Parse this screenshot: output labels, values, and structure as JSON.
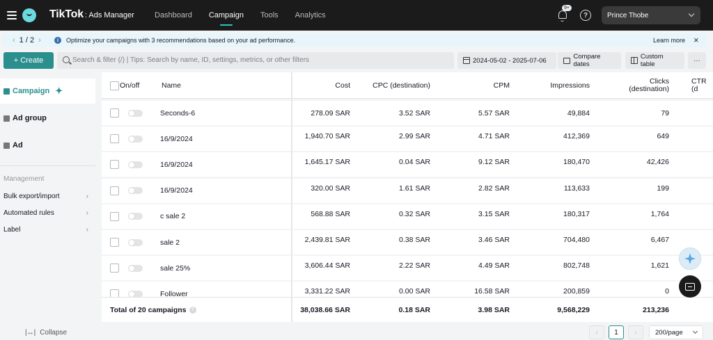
{
  "nav": {
    "brand": "TikTok",
    "brand_sub": ": Ads Manager",
    "links": [
      "Dashboard",
      "Campaign",
      "Tools",
      "Analytics"
    ],
    "notification_badge": "9+",
    "help_glyph": "?",
    "account_name": "Prince Thobe"
  },
  "recommendation": {
    "pager": "1 / 2",
    "message": "Optimize your campaigns with 3 recommendations based on your ad performance.",
    "learn_more": "Learn more"
  },
  "toolbar": {
    "create_label": "+ Create",
    "search_placeholder": "Search & filter (/) | Tips: Search by name, ID, settings, metrics, or other filters",
    "date_range": "2024-05-02 - 2025-07-06",
    "compare_label": "Compare dates",
    "custom_table_label": "Custom table",
    "more_label": "···"
  },
  "sidebar": {
    "levels": [
      "Campaign",
      "Ad group",
      "Ad"
    ],
    "management_heading": "Management",
    "management_links": [
      "Bulk export/import",
      "Automated rules",
      "Label"
    ],
    "collapse_label": "Collapse"
  },
  "table": {
    "headers": {
      "onoff": "On/off",
      "name": "Name",
      "cost": "Cost",
      "cpc": "CPC (destination)",
      "cpm": "CPM",
      "impressions": "Impressions",
      "clicks": "Clicks (destination)",
      "ctr": "CTR (d"
    },
    "rows": [
      {
        "name": "Seconds-6",
        "cost": "278.09 SAR",
        "cpc": "3.52 SAR",
        "cpm": "5.57 SAR",
        "impressions": "49,884",
        "clicks": "79"
      },
      {
        "name": "16/9/2024",
        "cost": "1,940.70 SAR",
        "cpc": "2.99 SAR",
        "cpm": "4.71 SAR",
        "impressions": "412,369",
        "clicks": "649"
      },
      {
        "name": "16/9/2024",
        "cost": "1,645.17 SAR",
        "cpc": "0.04 SAR",
        "cpm": "9.12 SAR",
        "impressions": "180,470",
        "clicks": "42,426"
      },
      {
        "name": "16/9/2024",
        "cost": "320.00 SAR",
        "cpc": "1.61 SAR",
        "cpm": "2.82 SAR",
        "impressions": "113,633",
        "clicks": "199"
      },
      {
        "name": "c sale 2",
        "cost": "568.88 SAR",
        "cpc": "0.32 SAR",
        "cpm": "3.15 SAR",
        "impressions": "180,317",
        "clicks": "1,764"
      },
      {
        "name": "sale 2",
        "cost": "2,439.81 SAR",
        "cpc": "0.38 SAR",
        "cpm": "3.46 SAR",
        "impressions": "704,480",
        "clicks": "6,467"
      },
      {
        "name": "sale 25%",
        "cost": "3,606.44 SAR",
        "cpc": "2.22 SAR",
        "cpm": "4.49 SAR",
        "impressions": "802,748",
        "clicks": "1,621"
      },
      {
        "name": "Follower",
        "cost": "3,331.22 SAR",
        "cpc": "0.00 SAR",
        "cpm": "16.58 SAR",
        "impressions": "200,859",
        "clicks": "0"
      }
    ],
    "totals": {
      "label": "Total of 20 campaigns",
      "cost": "38,038.66 SAR",
      "cpc": "0.18 SAR",
      "cpm": "3.98 SAR",
      "impressions": "9,568,229",
      "clicks": "213,236"
    }
  },
  "pagination": {
    "current_page": "1",
    "per_page": "200/page",
    "prev_glyph": "‹",
    "next_glyph": "›"
  },
  "colors": {
    "accent": "#2b8f8e",
    "nav_bg": "#1b1b1b"
  }
}
